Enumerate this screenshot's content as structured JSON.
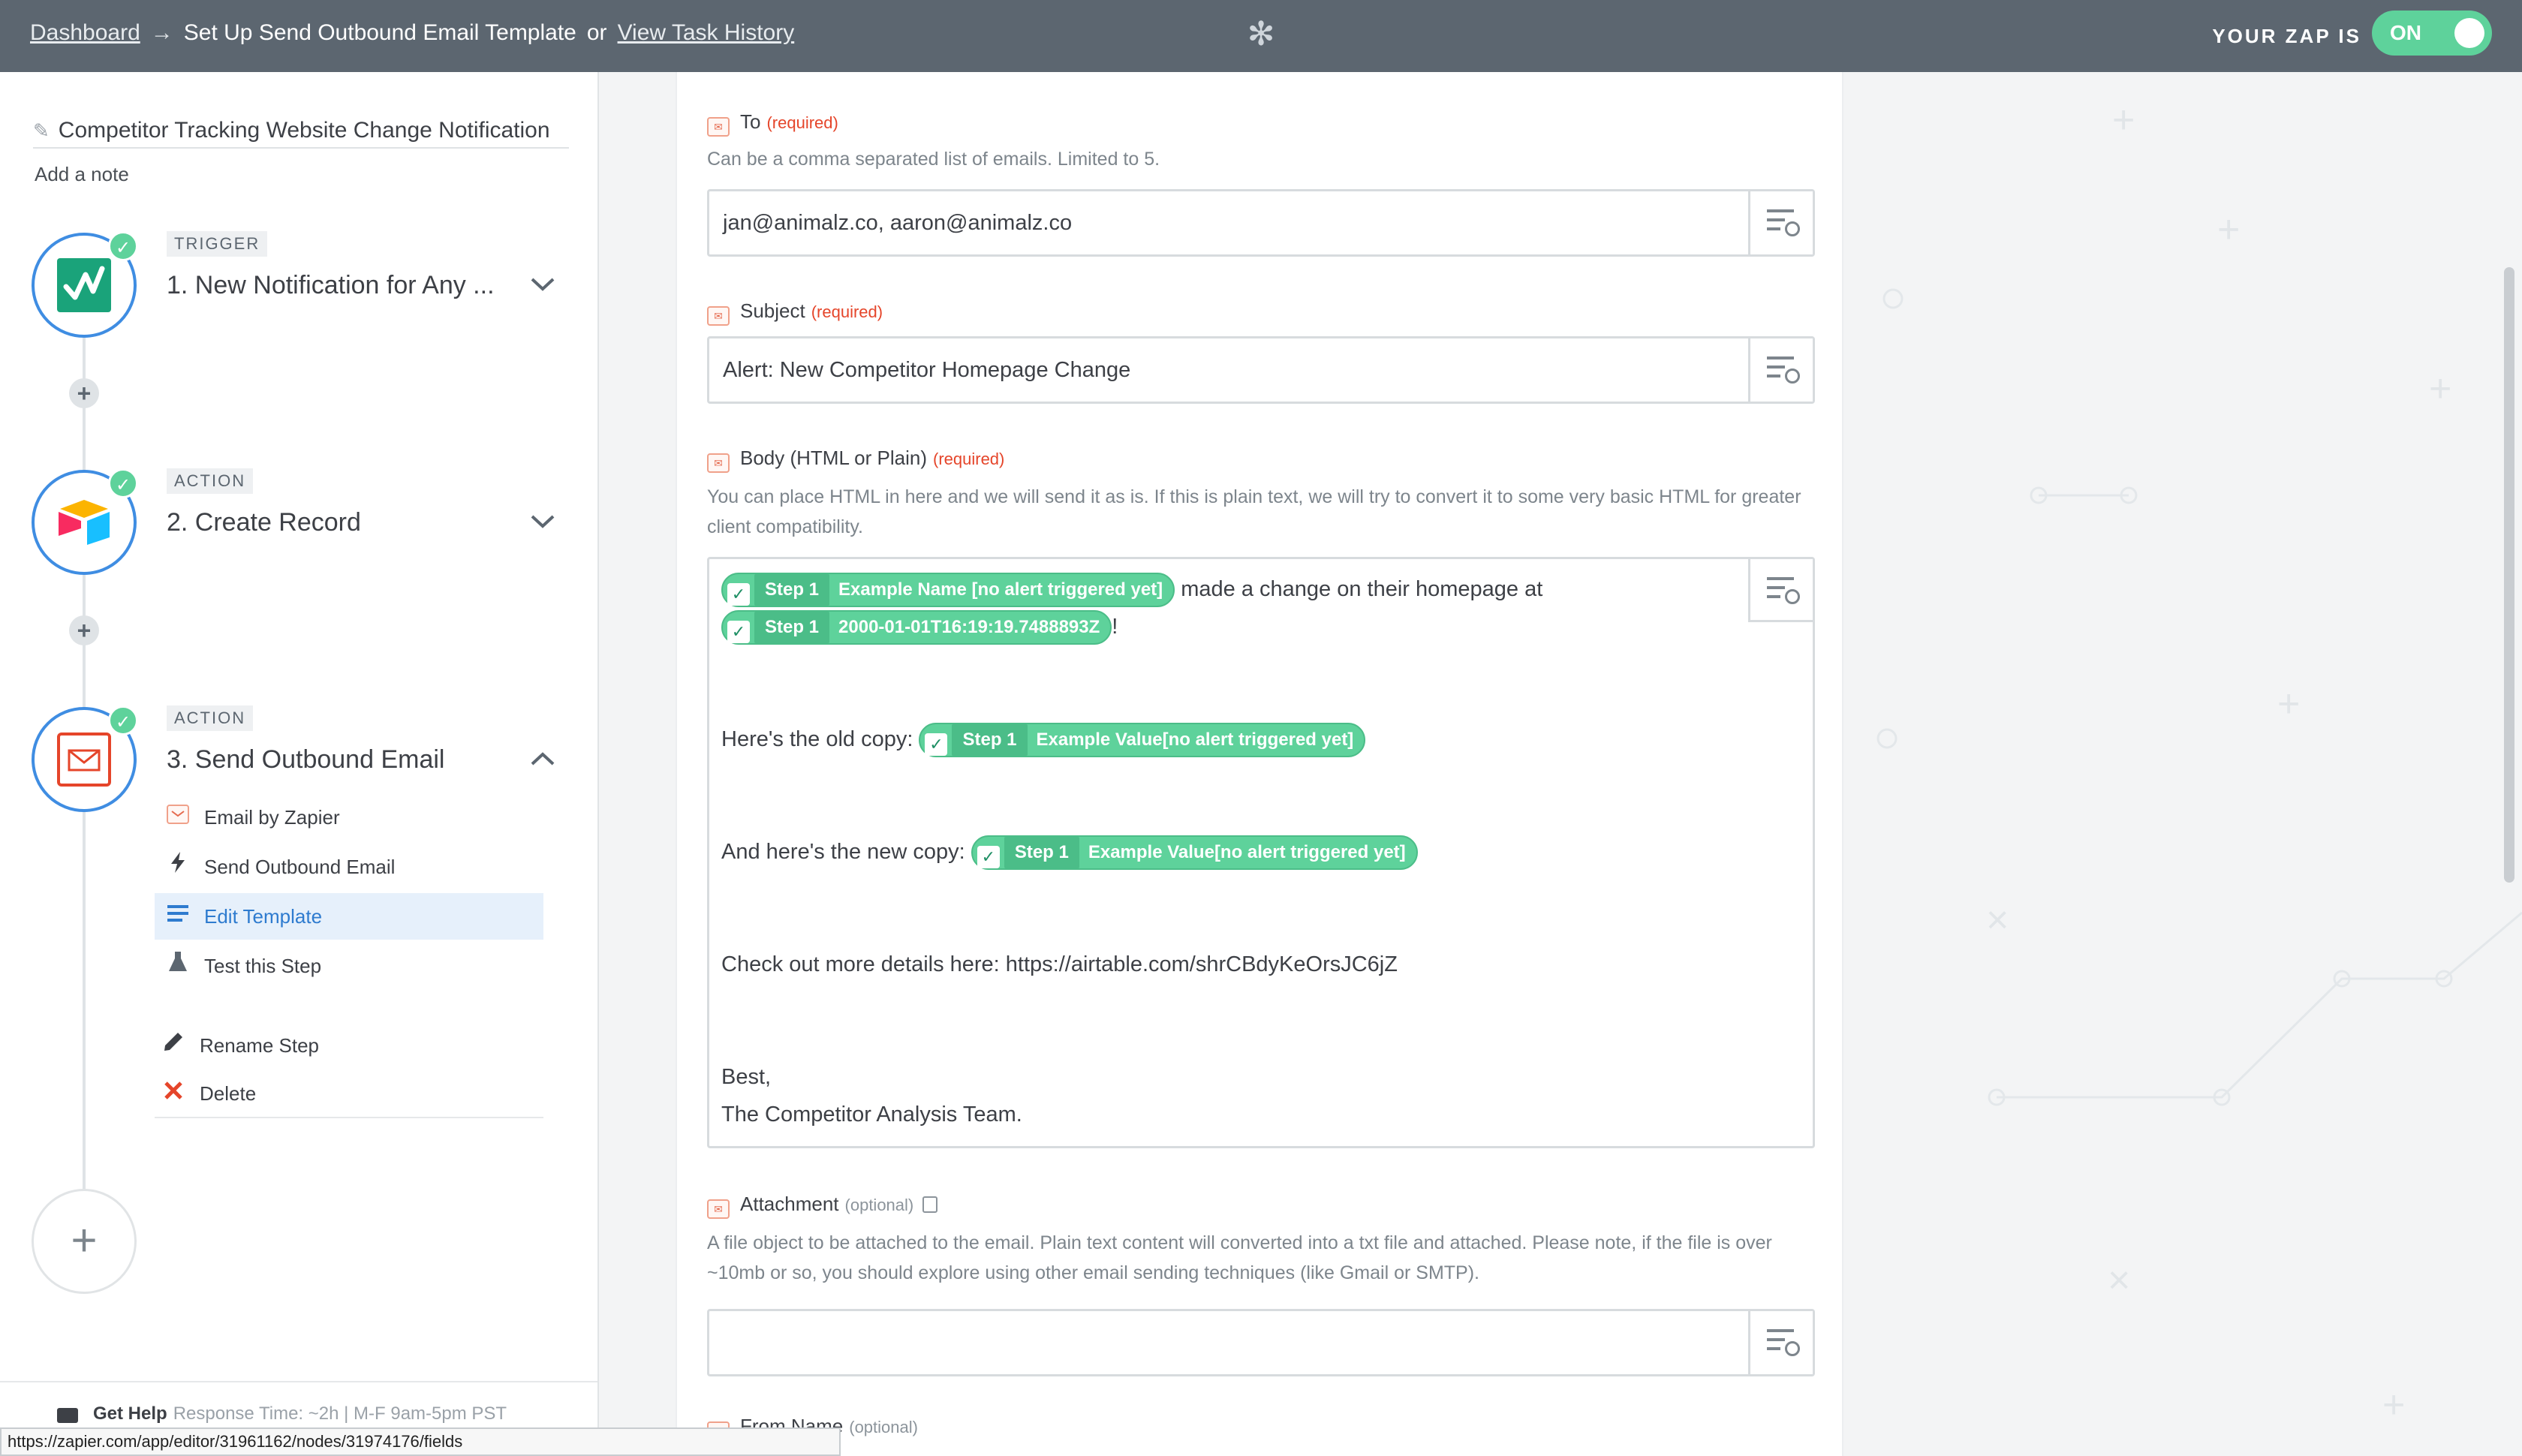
{
  "header": {
    "dashboard_link": "Dashboard",
    "arrow": "→",
    "current_title": "Set Up Send Outbound Email Template",
    "or": "or",
    "history_link": "View Task History",
    "status_label": "YOUR ZAP IS",
    "toggle_label": "ON",
    "toggle_color": "#5ed29b"
  },
  "sidebar": {
    "zap_name": "Competitor Tracking Website Change Notification",
    "add_note": "Add a note",
    "steps": [
      {
        "badge": "TRIGGER",
        "title": "1. New Notification for Any ...",
        "icon": "visualping-icon"
      },
      {
        "badge": "ACTION",
        "title": "2. Create Record",
        "icon": "airtable-icon"
      },
      {
        "badge": "ACTION",
        "title": "3. Send Outbound Email",
        "icon": "email-icon"
      }
    ],
    "sub_items": [
      {
        "label": "Email by Zapier",
        "icon": "email-app-icon"
      },
      {
        "label": "Send Outbound Email",
        "icon": "bolt-icon"
      },
      {
        "label": "Edit Template",
        "icon": "template-icon"
      },
      {
        "label": "Test this Step",
        "icon": "flask-icon"
      },
      {
        "label": "Rename Step",
        "icon": "pencil-icon"
      },
      {
        "label": "Delete",
        "icon": "delete-icon"
      }
    ],
    "get_help": "Get Help",
    "response_time": "Response Time: ~2h | M-F 9am-5pm PST"
  },
  "form": {
    "to": {
      "label": "To",
      "required": "(required)",
      "help": "Can be a comma separated list of emails. Limited to 5.",
      "value": "jan@animalz.co, aaron@animalz.co"
    },
    "subject": {
      "label": "Subject",
      "required": "(required)",
      "value": "Alert: New Competitor Homepage Change"
    },
    "body": {
      "label": "Body (HTML or Plain)",
      "required": "(required)",
      "help": "You can place HTML in here and we will send it as is. If this is plain text, we will try to convert it to some very basic HTML for greater client compatibility.",
      "pill_step": "Step 1",
      "pill_name": "Example Name [no alert triggered yet]",
      "line1_text": "made a change on their homepage at",
      "pill_date": "2000-01-01T16:19:19.7488893Z",
      "exclaim": "!",
      "old_copy_text": "Here's the old copy:",
      "pill_value_old": "Example Value[no alert triggered yet]",
      "new_copy_text": "And here's the new copy:",
      "pill_value_new": "Example Value[no alert triggered yet]",
      "details_text": "Check out more details here: https://airtable.com/shrCBdyKeOrsJC6jZ",
      "sign_off": "Best,",
      "team": "The Competitor Analysis Team."
    },
    "attachment": {
      "label": "Attachment",
      "optional": "(optional)",
      "help": "A file object to be attached to the email. Plain text content will converted into a txt file and attached. Please note, if the file is over ~10mb or so, you should explore using other email sending techniques (like Gmail or SMTP).",
      "value": ""
    },
    "from_name": {
      "label": "From Name",
      "optional": "(optional)"
    }
  },
  "status_url": "https://zapier.com/app/editor/31961162/nodes/31974176/fields"
}
